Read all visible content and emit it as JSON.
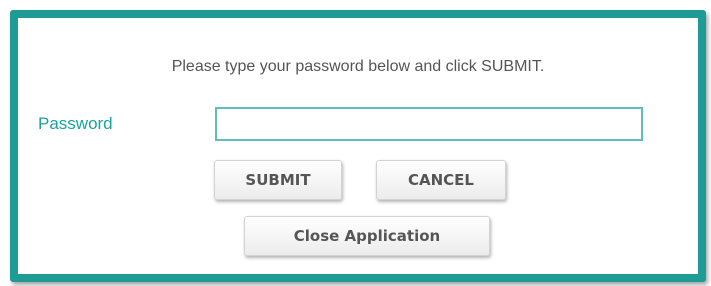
{
  "dialog": {
    "instruction": "Please type your password below and click SUBMIT.",
    "password_label": "Password",
    "password_value": "",
    "submit_label": "SUBMIT",
    "cancel_label": "CANCEL",
    "close_label": "Close Application"
  },
  "colors": {
    "frame_border": "#1f9b95",
    "label_text": "#1aa39c",
    "input_border": "#5fc0bb",
    "button_text": "#555555"
  }
}
